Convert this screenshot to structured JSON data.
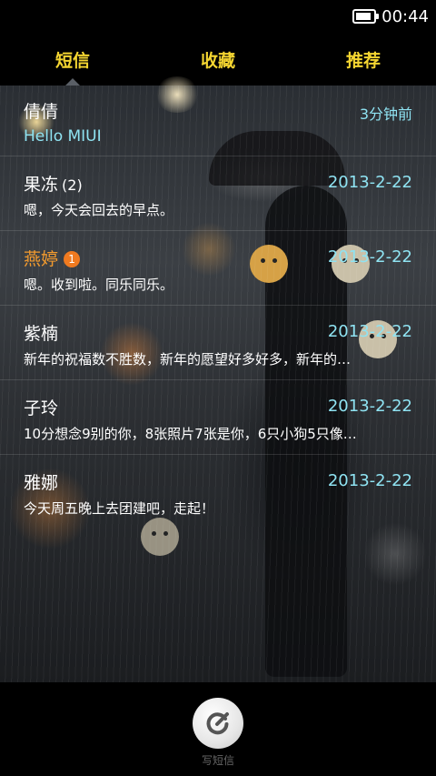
{
  "status_bar": {
    "time": "00:44",
    "battery_level": 0.9
  },
  "tabs": [
    {
      "label": "短信",
      "active": true
    },
    {
      "label": "收藏",
      "active": false
    },
    {
      "label": "推荐",
      "active": false
    }
  ],
  "messages": [
    {
      "sender": "倩倩",
      "count": "",
      "unread": "",
      "date": "3分钟前",
      "preview": "Hello MIUI"
    },
    {
      "sender": "果冻",
      "count": "(2)",
      "unread": "",
      "date": "2013-2-22",
      "preview": "嗯，今天会回去的早点。"
    },
    {
      "sender": "燕婷",
      "count": "",
      "unread": "1",
      "date": "2013-2-22",
      "preview": "嗯。收到啦。同乐同乐。"
    },
    {
      "sender": "紫楠",
      "count": "",
      "unread": "",
      "date": "2013-2-22",
      "preview": "新年的祝福数不胜数，新年的愿望好多好多，新年的…"
    },
    {
      "sender": "子玲",
      "count": "",
      "unread": "",
      "date": "2013-2-22",
      "preview": "10分想念9别的你，8张照片7张是你，6只小狗5只像…"
    },
    {
      "sender": "雅娜",
      "count": "",
      "unread": "",
      "date": "2013-2-22",
      "preview": "今天周五晚上去团建吧，走起！"
    }
  ],
  "bottom_bar": {
    "compose_label": "写短信",
    "compose_icon": "compose-icon"
  },
  "colors": {
    "tab_text": "#f5d631",
    "date_text": "#8fe3f2",
    "unread_name": "#f29a2e",
    "badge": "#f07a20"
  }
}
